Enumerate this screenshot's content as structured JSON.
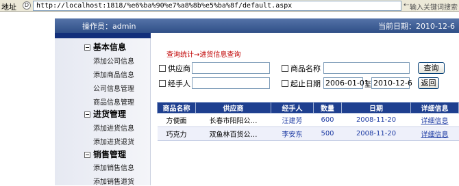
{
  "browser": {
    "address_label": "地址",
    "address_icon": "D",
    "url": "http://localhost:1818/%e6%ba%90%e7%a8%8b%e5%ba%8f/default.aspx",
    "search_placeholder": "输入关键词搜索"
  },
  "header": {
    "operator": "操作员：admin",
    "current_date": "当前日期：2010-12-6"
  },
  "sidebar": {
    "sections": [
      {
        "title": "基本信息",
        "items": [
          "添加公司信息",
          "添加商品信息",
          "公司信息管理",
          "商品信息管理"
        ]
      },
      {
        "title": "进货管理",
        "items": [
          "添加进货信息",
          "添加进货退货"
        ]
      },
      {
        "title": "销售管理",
        "items": [
          "添加销售信息",
          "添加销售退货"
        ]
      }
    ]
  },
  "breadcrumb": "查询统计→进货信息查询",
  "filters": {
    "supplier_label": "供应商",
    "supplier_value": "",
    "product_label": "商品名称",
    "product_value": "",
    "handler_label": "经手人",
    "handler_value": "",
    "date_label": "起止日期",
    "date_from": "2006-01-01",
    "date_sep": "至",
    "date_to": "2010-12-6",
    "query_button": "查询",
    "back_button": "返回"
  },
  "table": {
    "headers": [
      "商品名称",
      "供应商",
      "经手人",
      "数量",
      "日期",
      "详细信息"
    ],
    "rows": [
      [
        "方便面",
        "长春市阳阳公…",
        "汪建芳",
        "600",
        "2008-11-20",
        "详细信息"
      ],
      [
        "巧克力",
        "双鱼林百货公…",
        "李安东",
        "500",
        "2008-11-20",
        "详细信息"
      ]
    ]
  }
}
